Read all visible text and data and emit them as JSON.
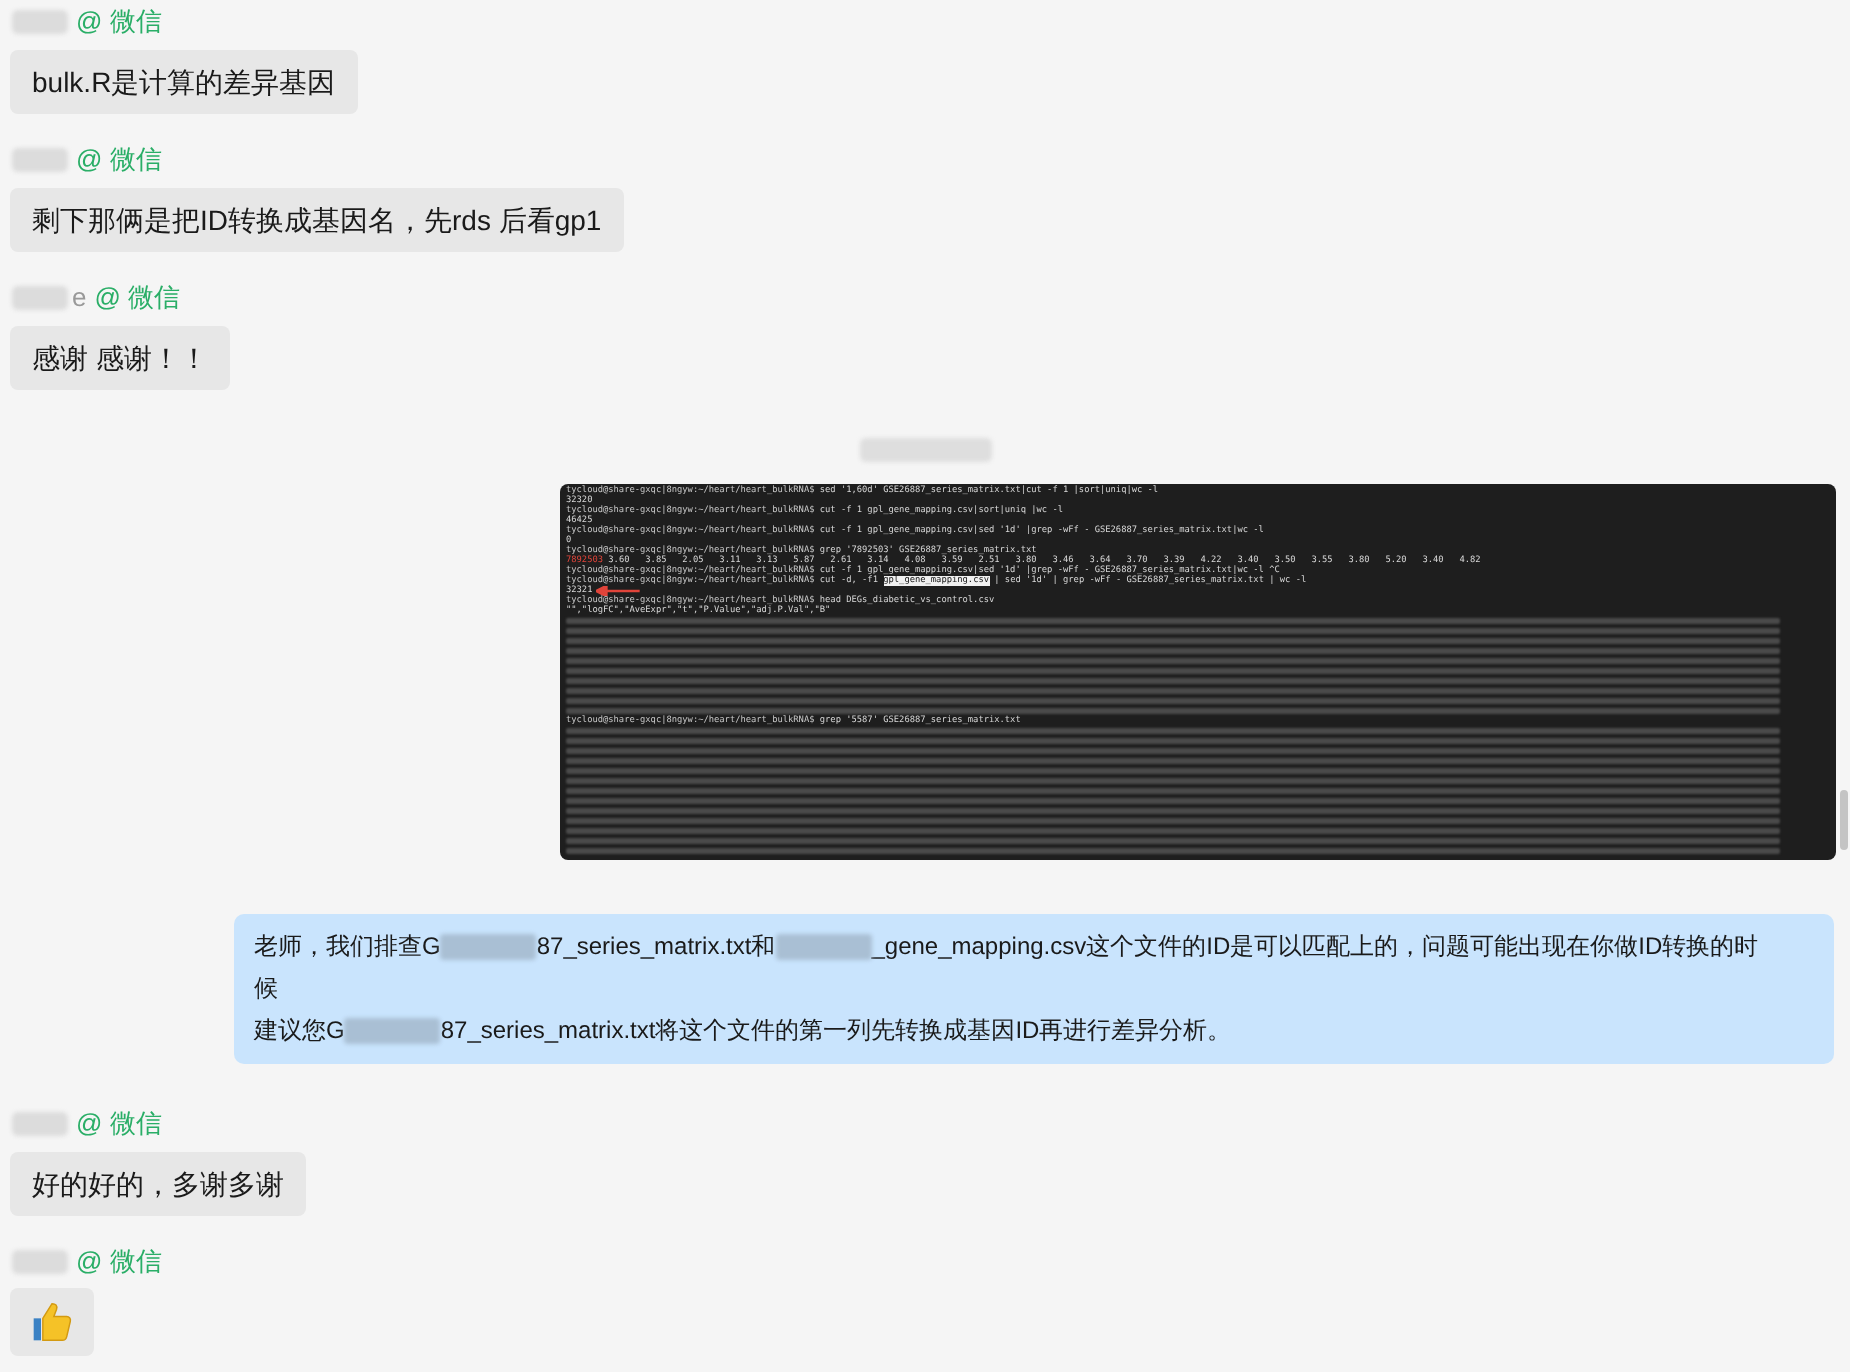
{
  "messages": [
    {
      "kind": "text",
      "sender": {
        "platform": "@ 微信"
      },
      "segments": [
        {
          "kind": "text",
          "text": "bulk.R是计算的差异基因"
        }
      ]
    },
    {
      "kind": "text",
      "sender": {
        "platform": "@ 微信"
      },
      "segments": [
        {
          "kind": "text",
          "text": "剩下那俩是把ID转换成基因名，先rds 后看gp1"
        }
      ]
    },
    {
      "kind": "text",
      "sender": {
        "visible": "e",
        "platform": "@ 微信"
      },
      "segments": [
        {
          "kind": "text",
          "text": "感谢  感谢！！"
        }
      ]
    },
    {
      "kind": "timestamp"
    },
    {
      "kind": "terminal",
      "lines": [
        {
          "kind": "text",
          "segments": [
            {
              "kind": "prompt",
              "text": "tycloud@share-gxqc|8ngyw:~/heart/heart_bulkRNA$"
            },
            {
              "kind": "plain",
              "text": " sed '1,60d' GSE26887_series_matrix.txt|cut -f 1 |sort|uniq|wc -l"
            }
          ]
        },
        {
          "kind": "text",
          "segments": [
            {
              "kind": "plain",
              "text": "32320"
            }
          ]
        },
        {
          "kind": "text",
          "segments": [
            {
              "kind": "prompt",
              "text": "tycloud@share-gxqc|8ngyw:~/heart/heart_bulkRNA$"
            },
            {
              "kind": "plain",
              "text": " cut -f 1 gpl_gene_mapping.csv|sort|uniq |wc -l"
            }
          ]
        },
        {
          "kind": "text",
          "segments": [
            {
              "kind": "plain",
              "text": "46425"
            }
          ]
        },
        {
          "kind": "text",
          "segments": [
            {
              "kind": "prompt",
              "text": "tycloud@share-gxqc|8ngyw:~/heart/heart_bulkRNA$"
            },
            {
              "kind": "plain",
              "text": " cut -f 1 gpl_gene_mapping.csv|sed '1d' |grep -wFf - GSE26887_series_matrix.txt|wc -l"
            }
          ]
        },
        {
          "kind": "text",
          "segments": [
            {
              "kind": "plain",
              "text": "0"
            }
          ]
        },
        {
          "kind": "text",
          "segments": [
            {
              "kind": "prompt",
              "text": "tycloud@share-gxqc|8ngyw:~/heart/heart_bulkRNA$"
            },
            {
              "kind": "plain",
              "text": " grep '7892503' GSE26887_series_matrix.txt"
            }
          ]
        },
        {
          "kind": "text",
          "segments": [
            {
              "kind": "match",
              "text": "7892503"
            },
            {
              "kind": "plain",
              "text": " 3.60   3.85   2.05   3.11   3.13   5.87   2.61   3.14   4.08   3.59   2.51   3.80   3.46   3.64   3.70   3.39   4.22   3.40   3.50   3.55   3.80   5.20   3.40   4.82"
            }
          ]
        },
        {
          "kind": "text",
          "segments": [
            {
              "kind": "prompt",
              "text": "tycloud@share-gxqc|8ngyw:~/heart/heart_bulkRNA$"
            },
            {
              "kind": "plain",
              "text": " cut -f 1 gpl_gene_mapping.csv|sed '1d' |grep -wFf - GSE26887_series_matrix.txt|wc -l ^C"
            }
          ]
        },
        {
          "kind": "text",
          "segments": [
            {
              "kind": "prompt",
              "text": "tycloud@share-gxqc|8ngyw:~/heart/heart_bulkRNA$"
            },
            {
              "kind": "plain",
              "text": " cut -d, -f1 "
            },
            {
              "kind": "highlight",
              "text": "gpl_gene_mapping.csv"
            },
            {
              "kind": "plain",
              "text": " | sed '1d' | grep -wFf - GSE26887_series_matrix.txt | wc -l"
            }
          ]
        },
        {
          "kind": "arrow",
          "segments": [
            {
              "kind": "plain",
              "text": "32321"
            }
          ]
        },
        {
          "kind": "text",
          "segments": [
            {
              "kind": "prompt",
              "text": "tycloud@share-gxqc|8ngyw:~/heart/heart_bulkRNA$"
            },
            {
              "kind": "plain",
              "text": " head DEGs_diabetic_vs_control.csv"
            }
          ]
        },
        {
          "kind": "text",
          "segments": [
            {
              "kind": "plain",
              "text": "\"\",\"logFC\",\"AveExpr\",\"t\",\"P.Value\",\"adj.P.Val\",\"B\""
            }
          ]
        },
        {
          "kind": "obscured"
        },
        {
          "kind": "obscured"
        },
        {
          "kind": "obscured"
        },
        {
          "kind": "obscured"
        },
        {
          "kind": "obscured"
        },
        {
          "kind": "obscured"
        },
        {
          "kind": "obscured"
        },
        {
          "kind": "obscured"
        },
        {
          "kind": "obscured"
        },
        {
          "kind": "obscured"
        },
        {
          "kind": "text",
          "segments": [
            {
              "kind": "prompt",
              "text": "tycloud@share-gxqc|8ngyw:~/heart/heart_bulkRNA$"
            },
            {
              "kind": "plain",
              "text": " grep '5587' GSE26887_series_matrix.txt"
            }
          ]
        },
        {
          "kind": "obscured"
        },
        {
          "kind": "obscured"
        },
        {
          "kind": "obscured"
        },
        {
          "kind": "obscured"
        },
        {
          "kind": "obscured"
        },
        {
          "kind": "obscured"
        },
        {
          "kind": "obscured"
        },
        {
          "kind": "obscured"
        },
        {
          "kind": "obscured"
        },
        {
          "kind": "obscured"
        },
        {
          "kind": "obscured"
        },
        {
          "kind": "obscured"
        },
        {
          "kind": "obscured"
        }
      ]
    },
    {
      "kind": "text",
      "segments": [
        {
          "kind": "text",
          "text": "老师，我们排查G"
        },
        {
          "kind": "redacted"
        },
        {
          "kind": "text",
          "text": "87_series_matrix.txt和"
        },
        {
          "kind": "redacted"
        },
        {
          "kind": "text",
          "text": "_gene_mapping.csv这个文件的ID是可以匹配上的，问题可能出现在你做ID转换的时"
        },
        {
          "kind": "break"
        },
        {
          "kind": "text",
          "text": "候"
        },
        {
          "kind": "break"
        },
        {
          "kind": "text",
          "text": "建议您G"
        },
        {
          "kind": "redacted"
        },
        {
          "kind": "text",
          "text": "87_series_matrix.txt将这个文件的第一列先转换成基因ID再进行差异分析。"
        }
      ]
    },
    {
      "kind": "text",
      "sender": {
        "platform": "@ 微信"
      },
      "segments": [
        {
          "kind": "text",
          "text": "好的好的，多谢多谢"
        }
      ]
    },
    {
      "kind": "sticker",
      "sender": {
        "platform": "@ 微信"
      }
    }
  ]
}
